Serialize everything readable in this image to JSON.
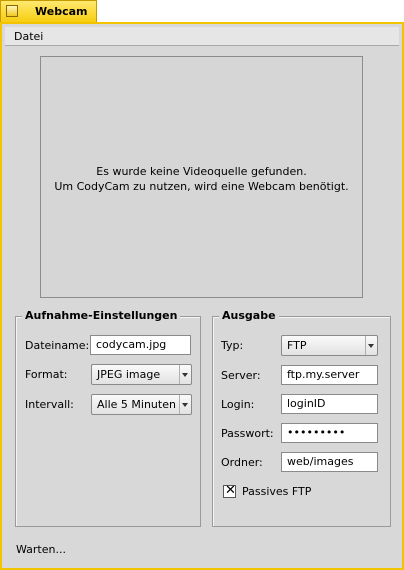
{
  "window": {
    "title": "Webcam"
  },
  "menu": {
    "items": [
      "Datei"
    ]
  },
  "video": {
    "message_line1": "Es wurde keine Videoquelle gefunden.",
    "message_line2": "Um CodyCam zu nutzen, wird eine Webcam benötigt."
  },
  "capture": {
    "title": "Aufnahme-Einstellungen",
    "filename_label": "Dateiname:",
    "filename_value": "codycam.jpg",
    "format_label": "Format:",
    "format_value": "JPEG image",
    "interval_label": "Intervall:",
    "interval_value": "Alle 5 Minuten"
  },
  "output": {
    "title": "Ausgabe",
    "type_label": "Typ:",
    "type_value": "FTP",
    "server_label": "Server:",
    "server_value": "ftp.my.server",
    "login_label": "Login:",
    "login_value": "loginID",
    "password_label": "Passwort:",
    "password_value": "•••••••••",
    "folder_label": "Ordner:",
    "folder_value": "web/images",
    "passive_ftp_label": "Passives FTP",
    "passive_ftp_checked": true
  },
  "status": {
    "text": "Warten..."
  }
}
